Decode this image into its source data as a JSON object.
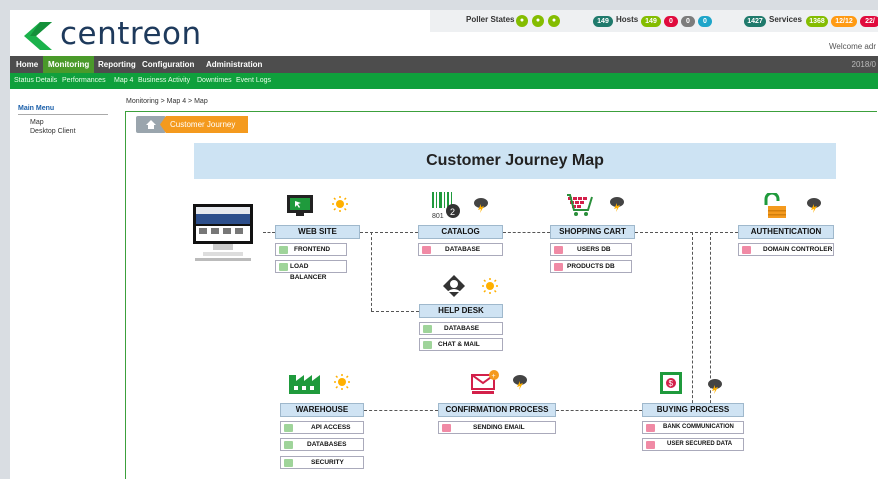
{
  "header": {
    "logo_text": "centreon",
    "poller_label": "Poller States",
    "hosts_count": "149",
    "hosts_label": "Hosts",
    "hosts_up": "149",
    "hosts_down": "0",
    "hosts_unreach": "0",
    "hosts_pending": "0",
    "services_count": "1427",
    "services_label": "Services",
    "svc_ok": "1368",
    "svc_warn": "12/12",
    "svc_crit": "22/",
    "welcome": "Welcome adr"
  },
  "nav": {
    "items": [
      "Home",
      "Monitoring",
      "Reporting",
      "Configuration",
      "Administration"
    ],
    "date": "2018/0",
    "sub_items": [
      "Status Details",
      "Performances",
      "Map 4",
      "Business Activity",
      "Downtimes",
      "Event Logs"
    ]
  },
  "sidebar": {
    "title": "Main Menu",
    "items": [
      "Map",
      "Desktop Client"
    ]
  },
  "breadcrumb": "Monitoring  >  Map 4  >  Map",
  "tab_label": "Customer Journey",
  "map": {
    "title": "Customer Journey Map",
    "catalog_code": "801",
    "groups": {
      "website": "WEB SITE",
      "catalog": "CATALOG",
      "cart": "SHOPPING CART",
      "auth": "AUTHENTICATION",
      "helpdesk": "HELP DESK",
      "warehouse": "WAREHOUSE",
      "confirm": "CONFIRMATION PROCESS",
      "buying": "BUYING PROCESS"
    },
    "services": {
      "frontend": "FRONTEND",
      "lb": "LOAD BALANCER",
      "cat_db": "DATABASE",
      "users_db": "USERS DB",
      "products_db": "PRODUCTS DB",
      "domain": "DOMAIN CONTROLER",
      "hd_db": "DATABASE",
      "chat": "CHAT & MAIL",
      "api": "API ACCESS",
      "dbs": "DATABASES",
      "security": "SECURITY",
      "email": "SENDING EMAIL",
      "bank": "BANK COMMUNICATION",
      "usd": "USER SECURED DATA"
    }
  },
  "colors": {
    "ok": "#9fd49a",
    "critical": "#f08aa5",
    "green": "#0fa03c",
    "orange": "#f49a1e"
  }
}
